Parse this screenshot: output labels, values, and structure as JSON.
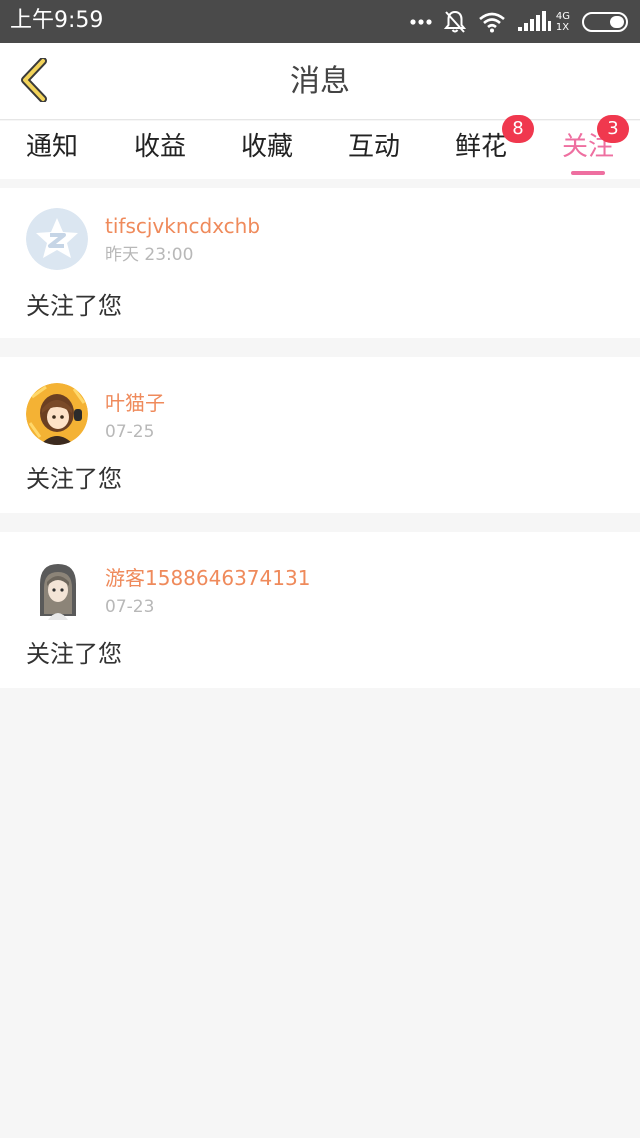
{
  "status_bar": {
    "time": "上午9:59",
    "network_top": "4G",
    "network_bottom": "1X",
    "icons": [
      "more-dots-icon",
      "bell-muted-icon",
      "wifi-icon",
      "signal-icon",
      "battery-icon"
    ]
  },
  "header": {
    "title": "消息",
    "back_icon": "chevron-left-icon"
  },
  "tabs": [
    {
      "label": "通知",
      "badge": ""
    },
    {
      "label": "收益",
      "badge": ""
    },
    {
      "label": "收藏",
      "badge": ""
    },
    {
      "label": "互动",
      "badge": ""
    },
    {
      "label": "鲜花",
      "badge": "8"
    },
    {
      "label": "关注",
      "badge": "3",
      "active": true
    }
  ],
  "messages": [
    {
      "username": "tifscjvkncdxchb",
      "time": "昨天 23:00",
      "text": "关注了您",
      "avatar": "default-qq-avatar"
    },
    {
      "username": "叶猫子",
      "time": "07-25",
      "text": "关注了您",
      "avatar": "anime-girl-avatar"
    },
    {
      "username": "游客1588646374131",
      "time": "07-23",
      "text": "关注了您",
      "avatar": "hooded-girl-avatar"
    }
  ],
  "colors": {
    "accent": "#ee6fa0",
    "username": "#ef8a5b",
    "badge": "#f0384e",
    "status_bar": "#4a4a4a",
    "background": "#f6f6f6"
  }
}
